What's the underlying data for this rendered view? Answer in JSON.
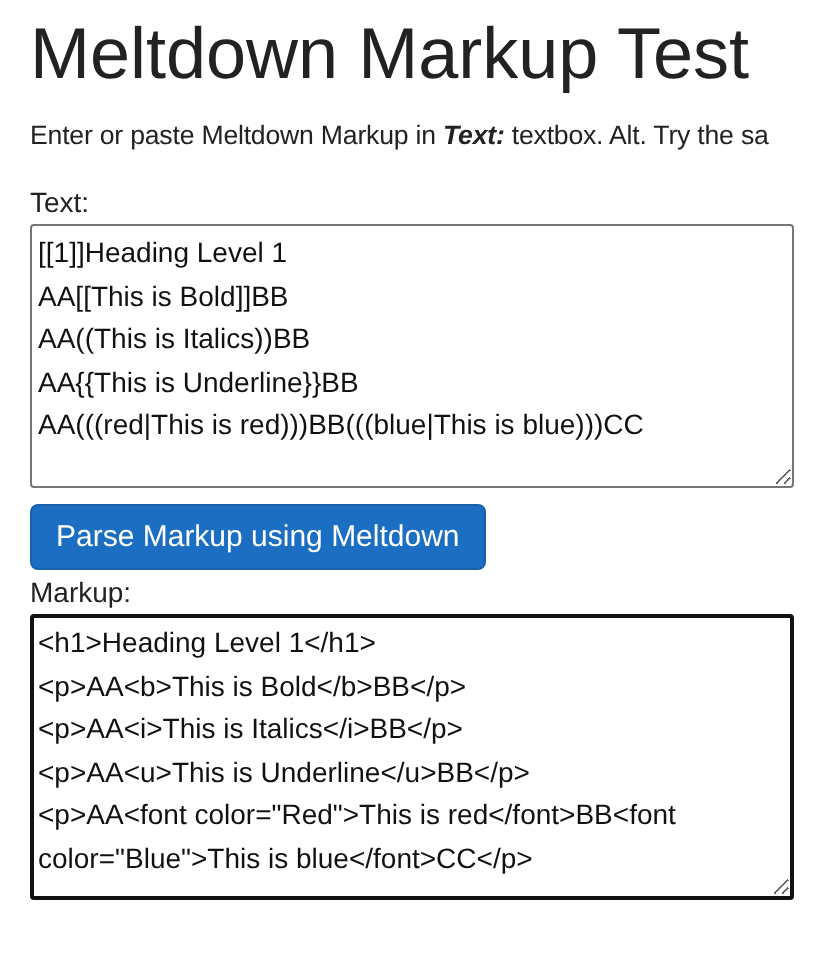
{
  "title": "Meltdown Markup Test",
  "intro": "Enter or paste Meltdown Markup in **Text:** textbox. Alt. Try the sa",
  "text_field": {
    "label": "Text:",
    "value": "[[1]]Heading Level 1\nAA[[This is Bold]]BB\nAA((This is Italics))BB\nAA{{This is Underline}}BB\nAA(((red|This is red)))BB(((blue|This is blue)))CC"
  },
  "parse_button": "Parse Markup using Meltdown",
  "markup_field": {
    "label": "Markup:",
    "value": "<h1>Heading Level 1</h1>\n<p>AA<b>This is Bold</b>BB</p>\n<p>AA<i>This is Italics</i>BB</p>\n<p>AA<u>This is Underline</u>BB</p>\n<p>AA<font color=\"Red\">This is red</font>BB<font color=\"Blue\">This is blue</font>CC</p>"
  }
}
